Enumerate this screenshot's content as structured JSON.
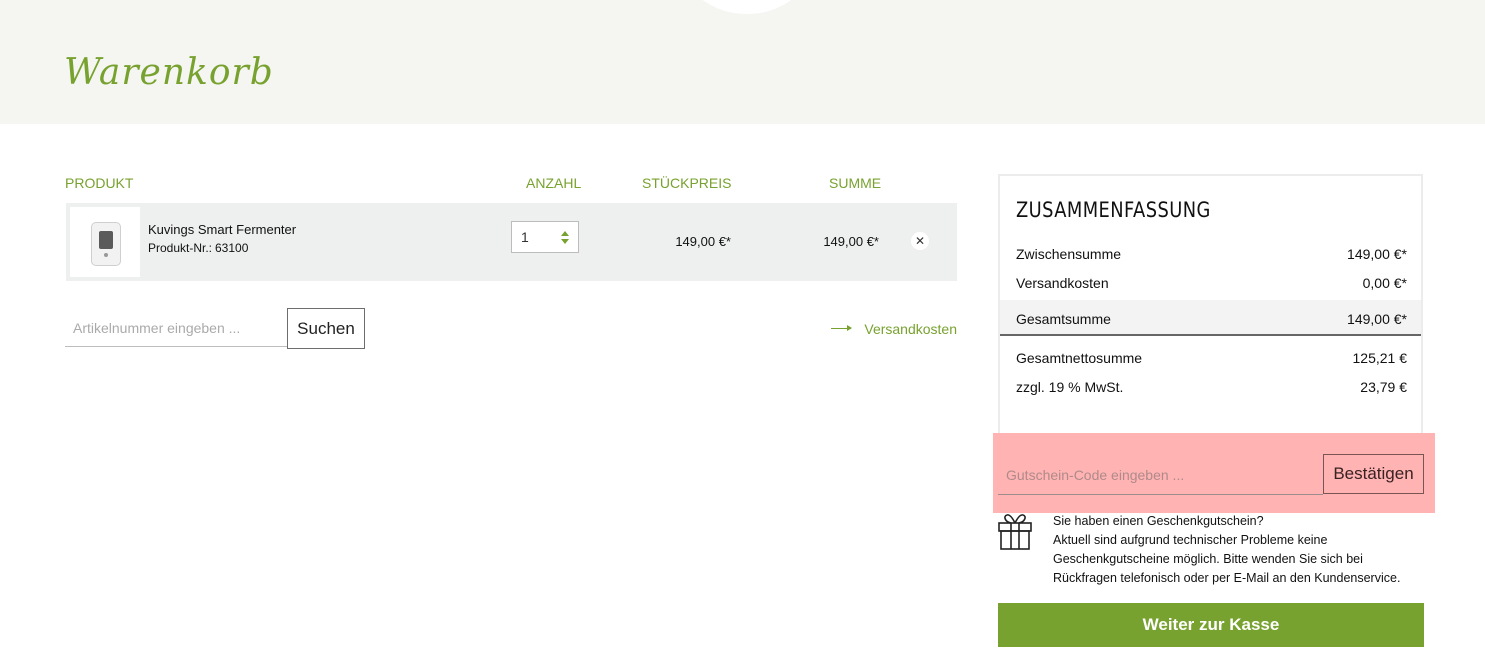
{
  "header": {
    "title": "Warenkorb"
  },
  "cart": {
    "columns": {
      "product": "PRODUKT",
      "quantity": "ANZAHL",
      "unit_price": "STÜCKPREIS",
      "sum": "SUMME"
    },
    "items": [
      {
        "name": "Kuvings Smart Fermenter",
        "product_nr_label": "Produkt-Nr.:",
        "product_nr": "63100",
        "quantity": "1",
        "unit_price": "149,00 €*",
        "sum": "149,00 €*",
        "remove_icon": "close-icon"
      }
    ]
  },
  "search": {
    "placeholder": "Artikelnummer eingeben ...",
    "button_label": "Suchen"
  },
  "shipping_link": {
    "label": "Versandkosten",
    "icon": "arrow-right-icon"
  },
  "summary": {
    "title": "ZUSAMMENFASSUNG",
    "rows": [
      {
        "label": "Zwischensumme",
        "value": "149,00 €*"
      },
      {
        "label": "Versandkosten",
        "value": "0,00 €*"
      },
      {
        "label": "Gesamtsumme",
        "value": "149,00 €*"
      },
      {
        "label": "Gesamtnettosumme",
        "value": "125,21 €"
      },
      {
        "label": "zzgl. 19 % MwSt.",
        "value": "23,79 €"
      }
    ]
  },
  "voucher": {
    "placeholder": "Gutschein-Code eingeben ...",
    "button_label": "Bestätigen"
  },
  "gift_notice": {
    "icon": "gift-icon",
    "lines": [
      "Sie haben einen Geschenkgutschein?",
      "Aktuell sind aufgrund technischer Probleme keine",
      "Geschenkgutscheine möglich. Bitte wenden Sie sich bei",
      "Rückfragen telefonisch oder per E-Mail an den Kundenservice."
    ]
  },
  "checkout": {
    "button_label": "Weiter zur Kasse"
  },
  "colors": {
    "accent": "#78a22f",
    "hero_bg": "#f5f5f1",
    "row_bg": "#eef0ef",
    "highlight": "#ffb3b3"
  }
}
